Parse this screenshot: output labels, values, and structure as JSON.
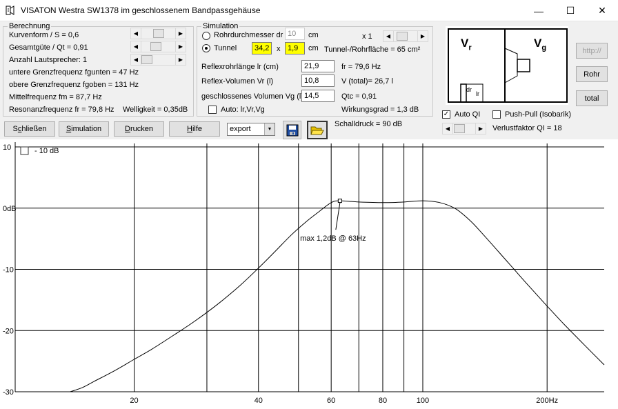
{
  "window": {
    "title": "VISATON Westra SW1378 im geschlossenem Bandpassgehäuse",
    "min": "—",
    "max": "☐",
    "close": "✕"
  },
  "berechnung": {
    "title": "Berechnung",
    "kurvenform": "Kurvenform / S = 0,6",
    "guete": "Gesamtgüte / Qt = 0,91",
    "anzahl": "Anzahl Lautsprecher: 1",
    "fgunten": "untere Grenzfrequenz fgunten = 47 Hz",
    "fgoben": "obere Grenzfrequenz fgoben = 131 Hz",
    "fm": "Mittelfrequenz fm = 87,7 Hz",
    "fr": "Resonanzfrequenz fr = 79,8 Hz",
    "welligkeit": "Welligkeit = 0,35dB"
  },
  "simulation": {
    "title": "Simulation",
    "rohr_label": "Rohrdurchmesser dr",
    "rohr_value": "10",
    "rohr_unit": "cm",
    "x1": "x 1",
    "tunnel_label": "Tunnel",
    "tunnel_w": "34,2",
    "times": "x",
    "tunnel_h": "1,9",
    "tunnel_unit": "cm",
    "tunnel_flaeche": "Tunnel-/Rohrfläche = 65 cm²",
    "reflexlaenge_label": "Reflexrohrlänge lr (cm)",
    "reflexlaenge_value": "21,9",
    "fr": "fr = 79,6 Hz",
    "vr_label": "Reflex-Volumen Vr (l)",
    "vr_value": "10,8",
    "vtotal": "V (total)= 26,7 l",
    "vg_label": "geschlossenes Volumen Vg (l)",
    "vg_value": "14,5",
    "qtc": "Qtc = 0,91",
    "auto_label": "Auto: lr,Vr,Vg",
    "wirkungsgrad": "Wirkungsgrad = 1,3 dB"
  },
  "toolbar": {
    "schliessen_pre": "S",
    "schliessen_ul": "c",
    "schliessen_post": "hließen",
    "simulation_pre": "",
    "simulation_ul": "S",
    "simulation_post": "imulation",
    "drucken_pre": "",
    "drucken_ul": "D",
    "drucken_post": "rucken",
    "hilfe_pre": "",
    "hilfe_ul": "H",
    "hilfe_post": "ilfe",
    "export_value": "export",
    "schalldruck": "Schalldruck = 90 dB"
  },
  "diagram": {
    "vr": "V",
    "vr_sub": "r",
    "vg": "V",
    "vg_sub": "g",
    "dr": "dr",
    "lr": "lr"
  },
  "right": {
    "http": "http://",
    "rohr": "Rohr",
    "total": "total",
    "autoql": "Auto QI",
    "pushpull": "Push-Pull (Isobarik)",
    "verlust": "Verlustfaktor QI = 18"
  },
  "chart_data": {
    "type": "line",
    "xscale": "log",
    "xlim": [
      10.3,
      275
    ],
    "ylim": [
      -30,
      10
    ],
    "grid": true,
    "y_ticks": [
      "10",
      "0dB",
      "-10",
      "-20",
      "-30"
    ],
    "x_ticks": [
      "20",
      "40",
      "60",
      "80",
      "100",
      "200Hz"
    ],
    "minus10_label": "- 10 dB",
    "annotation": "max 1,2dB @ 63Hz",
    "series": [
      {
        "x": [
          14,
          15,
          16,
          18,
          20,
          22,
          25,
          28,
          32,
          36,
          40,
          44,
          48,
          52,
          56,
          60,
          63,
          70,
          80,
          90,
          100,
          110,
          120,
          130,
          140,
          160,
          180,
          200,
          220,
          250,
          275
        ],
        "y": [
          -30,
          -29.3,
          -28.3,
          -26.5,
          -24.7,
          -23.1,
          -20.7,
          -18.5,
          -15.6,
          -12.7,
          -9.8,
          -7.0,
          -4.4,
          -2.3,
          -0.6,
          0.9,
          1.2,
          1.0,
          0.9,
          1.0,
          1.2,
          0.9,
          -0.1,
          -2.0,
          -4.3,
          -8.7,
          -12.6,
          -16.0,
          -19.0,
          -22.8,
          -25.6
        ]
      }
    ],
    "marker_x": 63,
    "marker_y": 1.2
  }
}
